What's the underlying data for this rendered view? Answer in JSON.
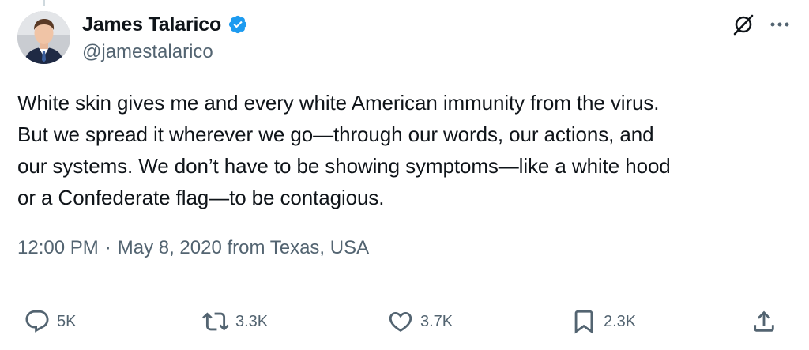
{
  "author": {
    "name": "James Talarico",
    "handle": "@jamestalarico",
    "verified": true
  },
  "header_icons": [
    "grok-icon",
    "more-icon"
  ],
  "tweet": {
    "text": "White skin gives me and every white American immunity from the virus.\nBut we spread it wherever we go—through our words, our actions, and\nour systems. We don’t have to be showing symptoms—like a white hood\nor a Confederate flag—to be contagious.",
    "time": "12:00 PM",
    "separator": "·",
    "date_location": "May 8, 2020 from Texas, USA"
  },
  "actions": {
    "reply": {
      "icon": "reply-icon",
      "count": "5K"
    },
    "retweet": {
      "icon": "retweet-icon",
      "count": "3.3K"
    },
    "like": {
      "icon": "heart-icon",
      "count": "3.7K"
    },
    "bookmark": {
      "icon": "bookmark-icon",
      "count": "2.3K"
    },
    "share": {
      "icon": "share-icon"
    }
  },
  "colors": {
    "text": "#0f1419",
    "secondary": "#536471",
    "verified": "#1d9bf0",
    "divider": "#eff3f4"
  }
}
